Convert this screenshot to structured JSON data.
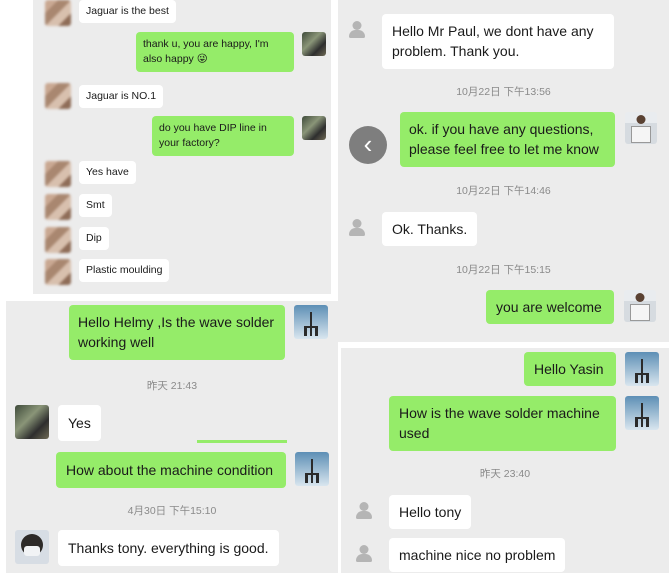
{
  "panel_tl": {
    "messages": [
      {
        "side": "left",
        "text": "Jaguar is the best"
      },
      {
        "side": "right",
        "text": "thank u, you are happy, I'm also happy 😜"
      },
      {
        "side": "left",
        "text": "Jaguar is NO.1"
      },
      {
        "side": "right",
        "text": "do you have DIP line in your factory?"
      },
      {
        "side": "left",
        "text": "Yes have"
      },
      {
        "side": "left",
        "text": "Smt"
      },
      {
        "side": "left",
        "text": "Dip"
      },
      {
        "side": "left",
        "text": "Plastic moulding"
      }
    ]
  },
  "panel_tr": {
    "messages": [
      {
        "side": "left",
        "text": "Hello Mr Paul, we dont have any problem. Thank you."
      },
      {
        "side": "right",
        "text": "ok. if you have any questions, please feel free to let me know"
      },
      {
        "side": "left",
        "text": "Ok. Thanks."
      },
      {
        "side": "right",
        "text": "you are welcome"
      }
    ],
    "times": [
      "10月22日 下午13:56",
      "10月22日 下午14:46",
      "10月22日 下午15:15"
    ],
    "back_glyph": "‹"
  },
  "panel_bl": {
    "messages": [
      {
        "side": "right",
        "text": "Hello Helmy ,Is the wave solder working well"
      },
      {
        "side": "left",
        "text": "Yes"
      },
      {
        "side": "right",
        "text": "How about the machine condition"
      },
      {
        "side": "left",
        "text": "Thanks tony.  everything is good."
      }
    ],
    "times": [
      "昨天 21:43",
      "4月30日 下午15:10"
    ]
  },
  "panel_br": {
    "messages": [
      {
        "side": "right",
        "text": "Hello Yasin"
      },
      {
        "side": "right",
        "text": "How is the wave solder machine used"
      },
      {
        "side": "left",
        "text": "Hello tony"
      },
      {
        "side": "left",
        "text": "machine nice no problem"
      }
    ],
    "times": [
      "昨天 23:40"
    ]
  },
  "colors": {
    "panel_bg": "#ececec",
    "bubble_green": "#95ec69",
    "bubble_white": "#ffffff",
    "time_text": "#8a8a8a"
  },
  "icons": [
    "default-avatar-icon",
    "eiffel-tower-avatar-icon",
    "back-arrow-icon"
  ]
}
